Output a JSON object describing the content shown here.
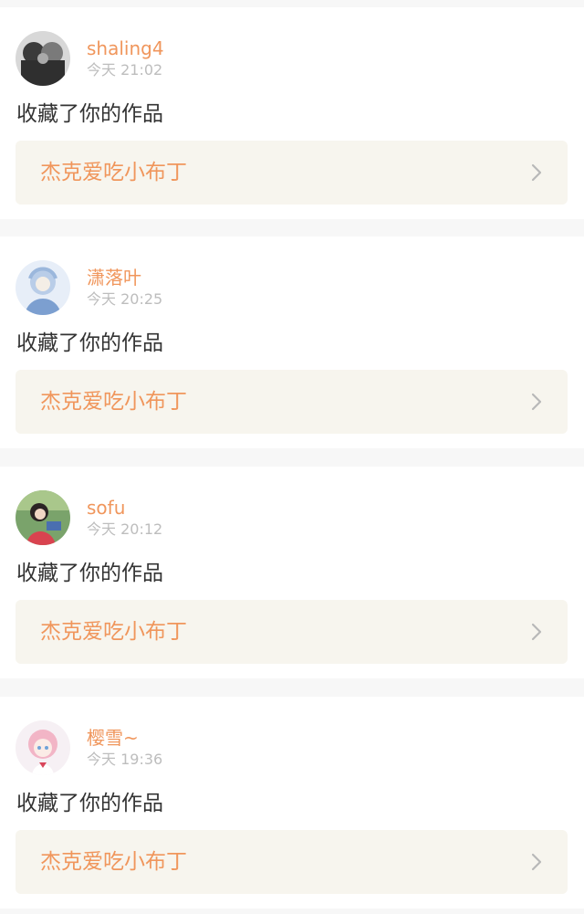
{
  "notifications": [
    {
      "username": "shaling4",
      "time": "今天 21:02",
      "action": "收藏了你的作品",
      "work_title": "杰克爱吃小布丁"
    },
    {
      "username": "潇落叶",
      "time": "今天 20:25",
      "action": "收藏了你的作品",
      "work_title": "杰克爱吃小布丁"
    },
    {
      "username": "sofu",
      "time": "今天 20:12",
      "action": "收藏了你的作品",
      "work_title": "杰克爱吃小布丁"
    },
    {
      "username": "樱雪~",
      "time": "今天 19:36",
      "action": "收藏了你的作品",
      "work_title": "杰克爱吃小布丁"
    }
  ],
  "colors": {
    "accent": "#f0965c",
    "text": "#333333",
    "muted": "#bdbdbd",
    "card_link_bg": "#f7f5ee",
    "page_bg": "#f7f7f7"
  },
  "icons": {
    "chevron": "chevron-right-icon",
    "avatar": "avatar"
  }
}
